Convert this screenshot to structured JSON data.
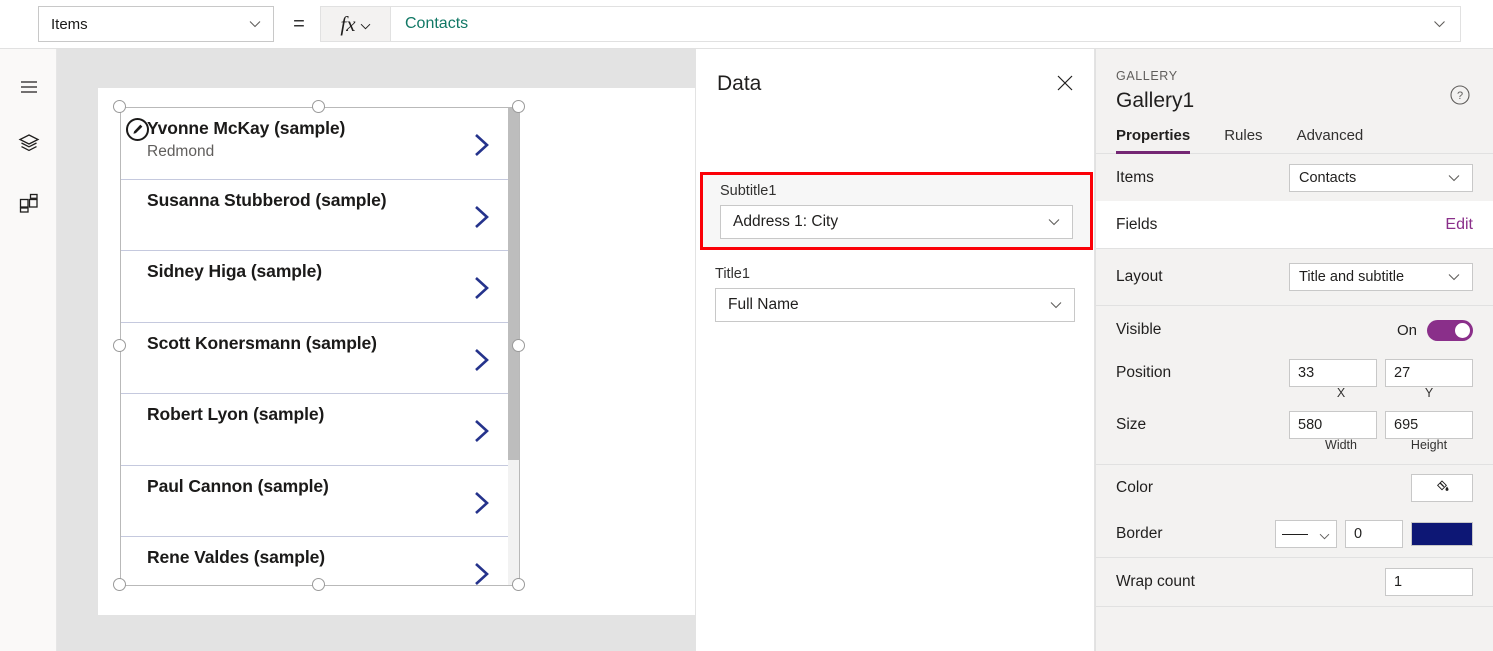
{
  "formula_bar": {
    "property_selected": "Items",
    "equals": "=",
    "fx_label": "fx",
    "formula_value": "Contacts",
    "formula_color": "#117865"
  },
  "left_rail": {
    "items": [
      {
        "name": "hamburger-menu-icon",
        "label": "Menu"
      },
      {
        "name": "tree-view-icon",
        "label": "Tree view"
      },
      {
        "name": "insert-icon",
        "label": "Insert"
      }
    ]
  },
  "canvas": {
    "gallery": {
      "rows": [
        {
          "title": "Yvonne McKay (sample)",
          "subtitle": "Redmond"
        },
        {
          "title": "Susanna Stubberod (sample)",
          "subtitle": ""
        },
        {
          "title": "Sidney Higa (sample)",
          "subtitle": ""
        },
        {
          "title": "Scott Konersmann (sample)",
          "subtitle": ""
        },
        {
          "title": "Robert Lyon (sample)",
          "subtitle": ""
        },
        {
          "title": "Paul Cannon (sample)",
          "subtitle": ""
        },
        {
          "title": "Rene Valdes (sample)",
          "subtitle": ""
        }
      ],
      "chevron_color": "#25338c",
      "separator_color": "#c5c9de"
    }
  },
  "data_panel": {
    "title": "Data",
    "close_label": "Close",
    "fields": [
      {
        "label": "Subtitle1",
        "value": "Address 1: City",
        "highlighted": true
      },
      {
        "label": "Title1",
        "value": "Full Name",
        "highlighted": false
      }
    ],
    "highlight_color": "#fb0007"
  },
  "properties_panel": {
    "kicker": "GALLERY",
    "control_name": "Gallery1",
    "help_label": "Help",
    "tabs": [
      {
        "label": "Properties",
        "active": true
      },
      {
        "label": "Rules",
        "active": false
      },
      {
        "label": "Advanced",
        "active": false
      }
    ],
    "accent_color": "#742774",
    "rows": {
      "items": {
        "label": "Items",
        "value": "Contacts"
      },
      "fields": {
        "label": "Fields",
        "action": "Edit"
      },
      "layout": {
        "label": "Layout",
        "value": "Title and subtitle"
      },
      "visible": {
        "label": "Visible",
        "state": "On"
      },
      "position": {
        "label": "Position",
        "x": "33",
        "y": "27",
        "x_caption": "X",
        "y_caption": "Y"
      },
      "size": {
        "label": "Size",
        "width": "580",
        "height": "695",
        "width_caption": "Width",
        "height_caption": "Height"
      },
      "color": {
        "label": "Color",
        "icon": "paint-bucket-icon"
      },
      "border": {
        "label": "Border",
        "style": "solid",
        "width": "0",
        "swatch": "#0d1775"
      },
      "wrap_count": {
        "label": "Wrap count",
        "value": "1"
      }
    }
  }
}
